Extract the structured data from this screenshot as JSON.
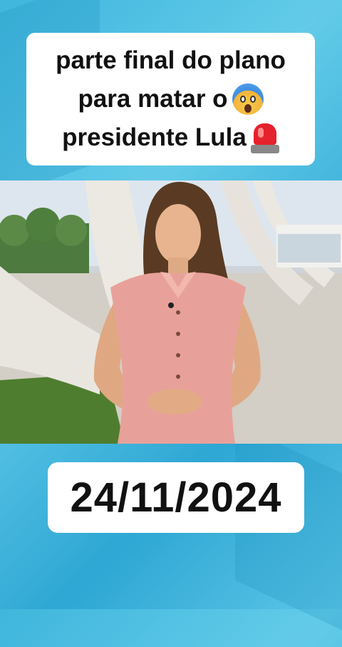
{
  "headline": {
    "line1": "parte final do plano",
    "line2": "para matar o",
    "line3": "presidente Lula",
    "emoji1": "screaming-face-emoji",
    "emoji2": "police-siren-emoji"
  },
  "photo": {
    "subject": "news-presenter-photo"
  },
  "date": "24/11/2024",
  "colors": {
    "background": "#3fb6dc",
    "box": "#ffffff",
    "text": "#111111",
    "dress": "#e8a19a"
  }
}
